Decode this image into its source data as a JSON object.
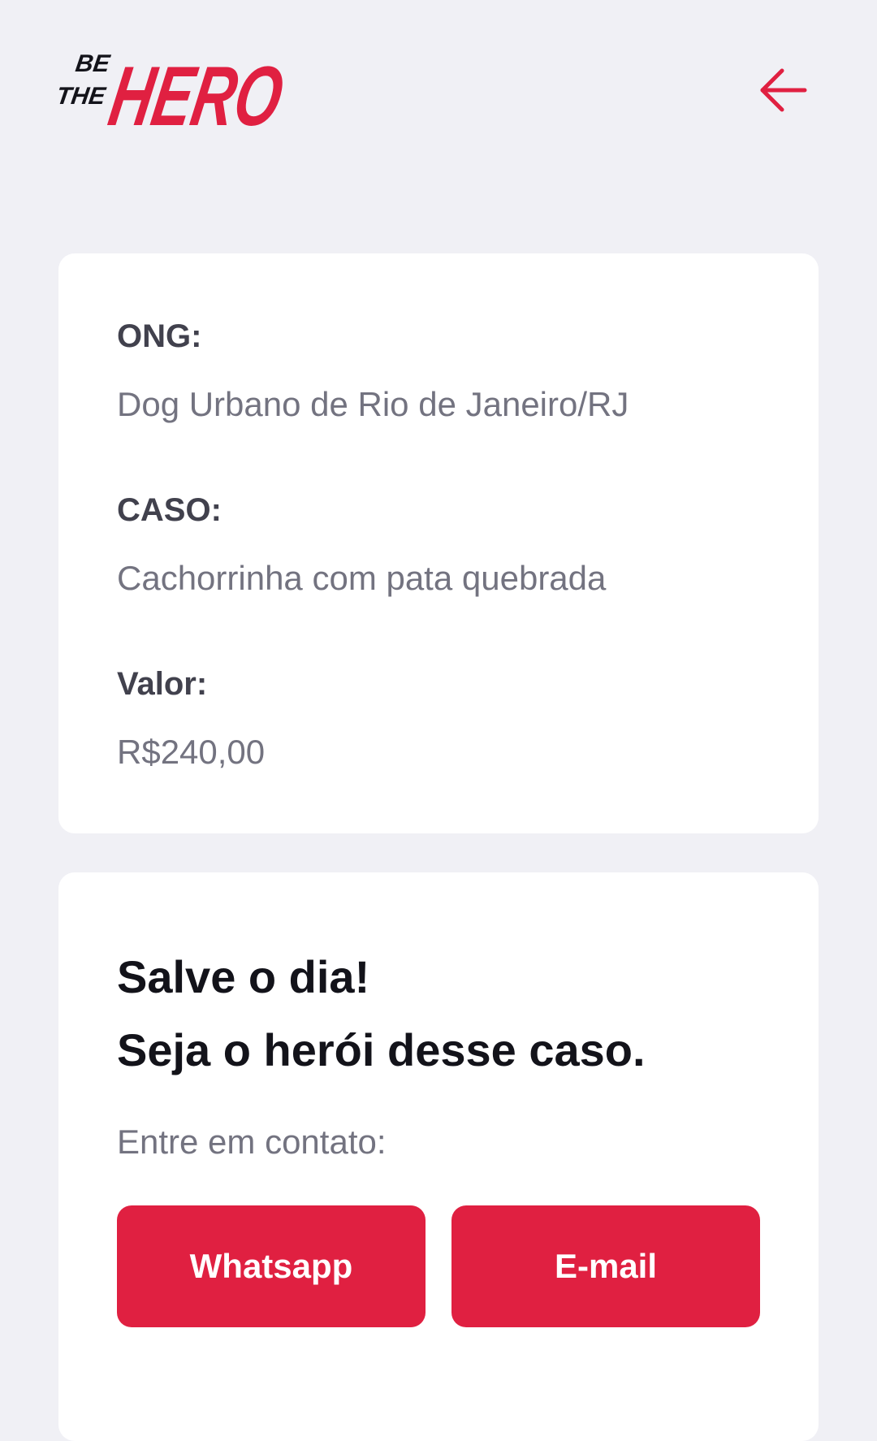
{
  "app": {
    "logo_alt": "Be The Hero",
    "logo_lines": {
      "be": "BE",
      "the": "THE",
      "hero": "HERO"
    },
    "back_icon": "arrow-left-icon",
    "accent_color": "#e02041"
  },
  "incident": {
    "ong_label": "ONG:",
    "ong_value": "Dog Urbano de Rio de Janeiro/RJ",
    "case_label": "CASO:",
    "case_value": "Cachorrinha com pata quebrada",
    "value_label": "Valor:",
    "value_value": "R$240,00"
  },
  "contact": {
    "title_line1": "Salve o dia!",
    "title_line2": "Seja o herói desse caso.",
    "hint": "Entre em contato:",
    "whatsapp_label": "Whatsapp",
    "email_label": "E-mail"
  }
}
